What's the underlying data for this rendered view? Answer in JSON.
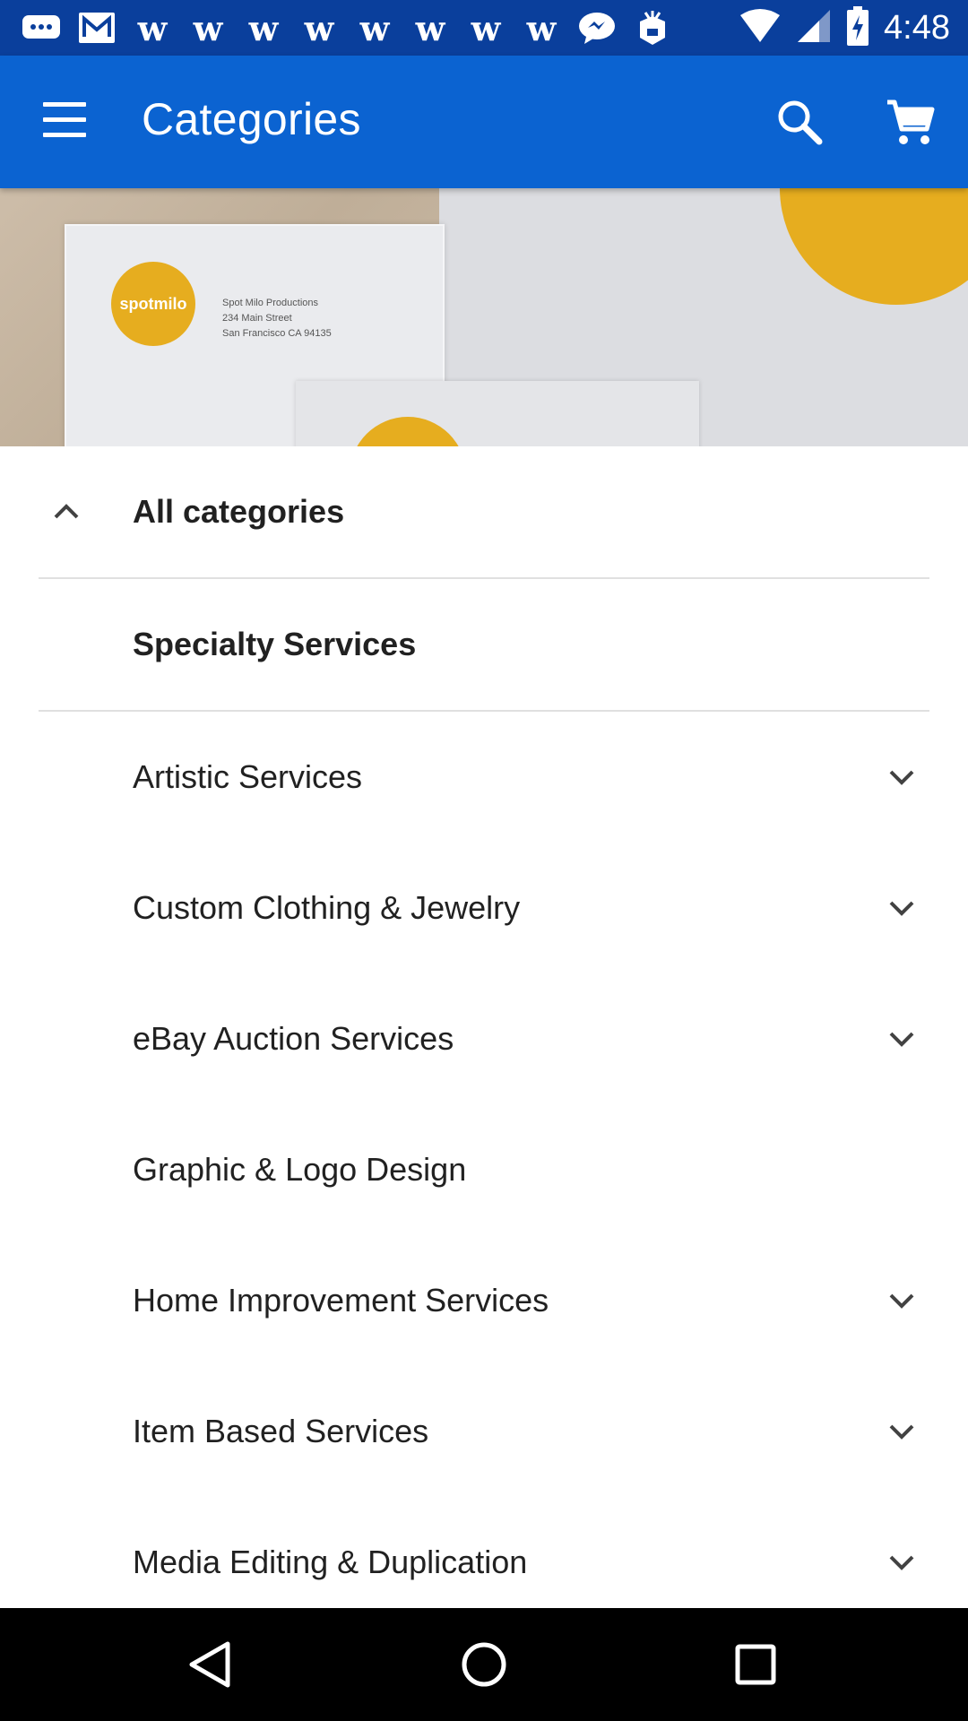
{
  "status_bar": {
    "time": "4:48",
    "notification_icons": [
      "chat-icon",
      "mail-icon",
      "w-icon",
      "w-icon",
      "w-icon",
      "w-icon",
      "w-icon",
      "w-icon",
      "w-icon",
      "w-icon",
      "messenger-icon",
      "app-box-icon"
    ],
    "right_icons": [
      "wifi-icon",
      "signal-icon",
      "battery-charging-icon"
    ]
  },
  "app_bar": {
    "title": "Categories",
    "menu_icon": "menu-icon",
    "search_icon": "search-icon",
    "cart_icon": "cart-icon",
    "color": "#0b63d1"
  },
  "hero": {
    "logo_text": "spotmilo",
    "address_lines": [
      "Spot Milo Productions",
      "234 Main Street",
      "San Francisco CA 94135"
    ]
  },
  "categories": {
    "header": "All categories",
    "section": "Specialty Services",
    "items": [
      {
        "label": "Artistic Services",
        "expandable": true
      },
      {
        "label": "Custom Clothing & Jewelry",
        "expandable": true
      },
      {
        "label": "eBay Auction Services",
        "expandable": true
      },
      {
        "label": "Graphic & Logo Design",
        "expandable": false
      },
      {
        "label": "Home Improvement Services",
        "expandable": true
      },
      {
        "label": "Item Based Services",
        "expandable": true
      },
      {
        "label": "Media Editing & Duplication",
        "expandable": true
      }
    ]
  },
  "nav_bar": {
    "icons": [
      "back-icon",
      "home-icon",
      "recents-icon"
    ]
  }
}
